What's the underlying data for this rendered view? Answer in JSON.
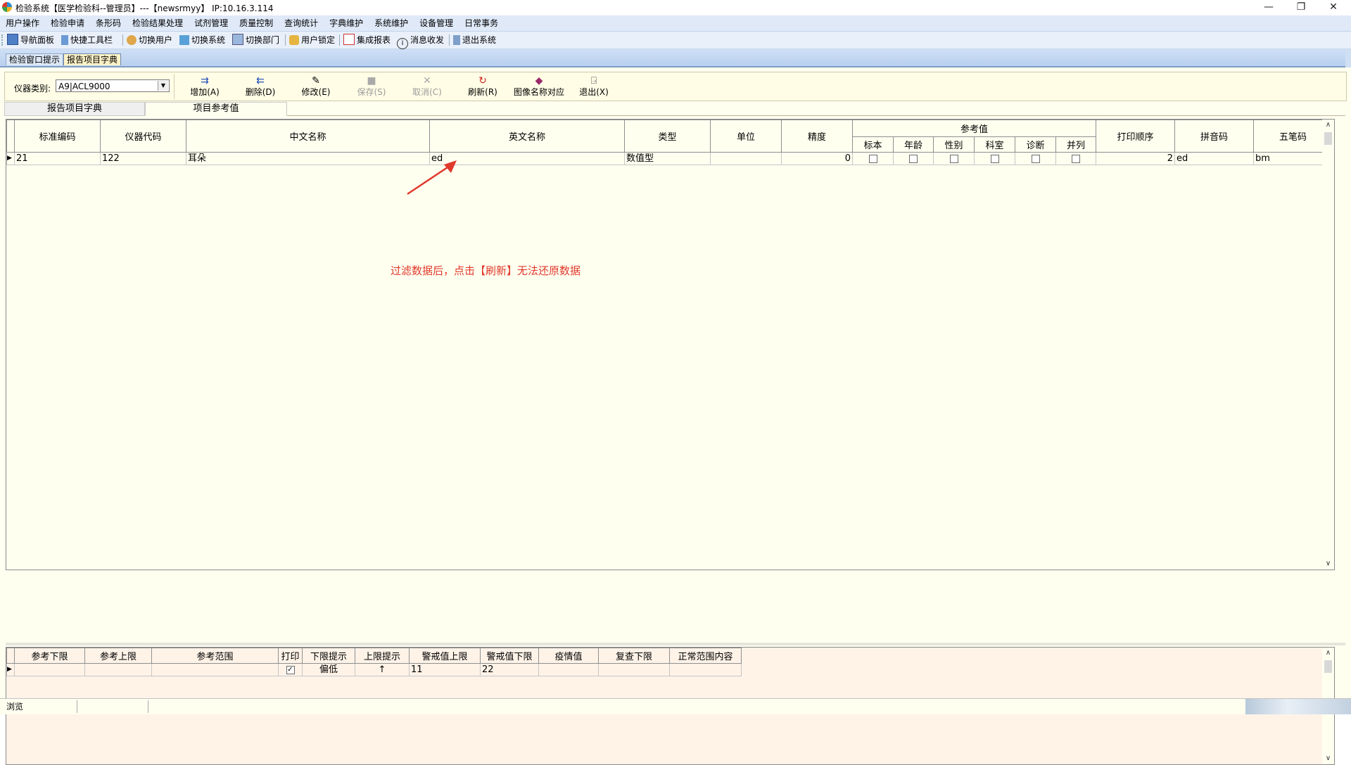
{
  "window": {
    "title": "检验系统【医学检验科--管理员】---【newsrmyy】 IP:10.16.3.114",
    "controls": {
      "minimize": "—",
      "restore": "❐",
      "close": "✕"
    }
  },
  "menu": [
    "用户操作",
    "检验申请",
    "条形码",
    "检验结果处理",
    "试剂管理",
    "质量控制",
    "查询统计",
    "字典维护",
    "系统维护",
    "设备管理",
    "日常事务"
  ],
  "toolbar": {
    "nav_panel": "导航面板",
    "quick_toolbar": "快捷工具栏",
    "switch_user": "切换用户",
    "switch_system": "切换系统",
    "switch_dept": "切换部门",
    "lock_user": "用户锁定",
    "integrated_report": "集成报表",
    "messages": "消息收发",
    "exit_system": "退出系统"
  },
  "doc_tabs": [
    "检验窗口提示",
    "报告项目字典"
  ],
  "content_toolbar": {
    "instrument_label": "仪器类别:",
    "instrument_value": "A9|ACL9000",
    "add": "增加(A)",
    "delete": "删除(D)",
    "modify": "修改(E)",
    "save": "保存(S)",
    "cancel": "取消(C)",
    "refresh": "刷新(R)",
    "image_name_map": "图像名称对应",
    "exit": "退出(X)"
  },
  "sub_tabs": [
    "报告项目字典",
    "项目参考值"
  ],
  "main_grid": {
    "headers": {
      "std_code": "标准编码",
      "inst_code": "仪器代码",
      "cn_name": "中文名称",
      "en_name": "英文名称",
      "type": "类型",
      "unit": "单位",
      "precision": "精度",
      "ref_group": "参考值",
      "ref_sample": "标本",
      "ref_age": "年龄",
      "ref_sex": "性别",
      "ref_dept": "科室",
      "ref_diag": "诊断",
      "ref_merge": "并列",
      "print_order": "打印顺序",
      "pinyin": "拼音码",
      "wubi": "五笔码"
    },
    "row": {
      "std_code": "21",
      "inst_code": "122",
      "cn_name": "耳朵",
      "en_name": "ed",
      "type": "数值型",
      "unit": "",
      "precision": "0",
      "print_order": "2",
      "pinyin": "ed",
      "wubi": "bm"
    }
  },
  "annotation": "过滤数据后，点击【刷新】无法还原数据",
  "ref_grid": {
    "headers": {
      "lower": "参考下限",
      "upper": "参考上限",
      "range": "参考范围",
      "print": "打印",
      "low_hint": "下限提示",
      "high_hint": "上限提示",
      "alert_upper": "警戒值上限",
      "alert_lower": "警戒值下限",
      "epidemic": "疫情值",
      "recheck_lower": "复查下限",
      "normal_content": "正常范围内容"
    },
    "row": {
      "lower": "",
      "upper": "",
      "range": "",
      "print_checked": "✓",
      "low_hint": "偏低",
      "high_hint": "↑",
      "alert_upper": "11",
      "alert_lower": "22",
      "epidemic": "",
      "recheck_lower": "",
      "normal_content": ""
    }
  },
  "status": {
    "mode": "浏览"
  },
  "colors": {
    "annotation": "#e0392b",
    "content_bg": "#fffff0",
    "ref_bg": "#fff3e8",
    "menu_bg": "#dfe9f8"
  }
}
